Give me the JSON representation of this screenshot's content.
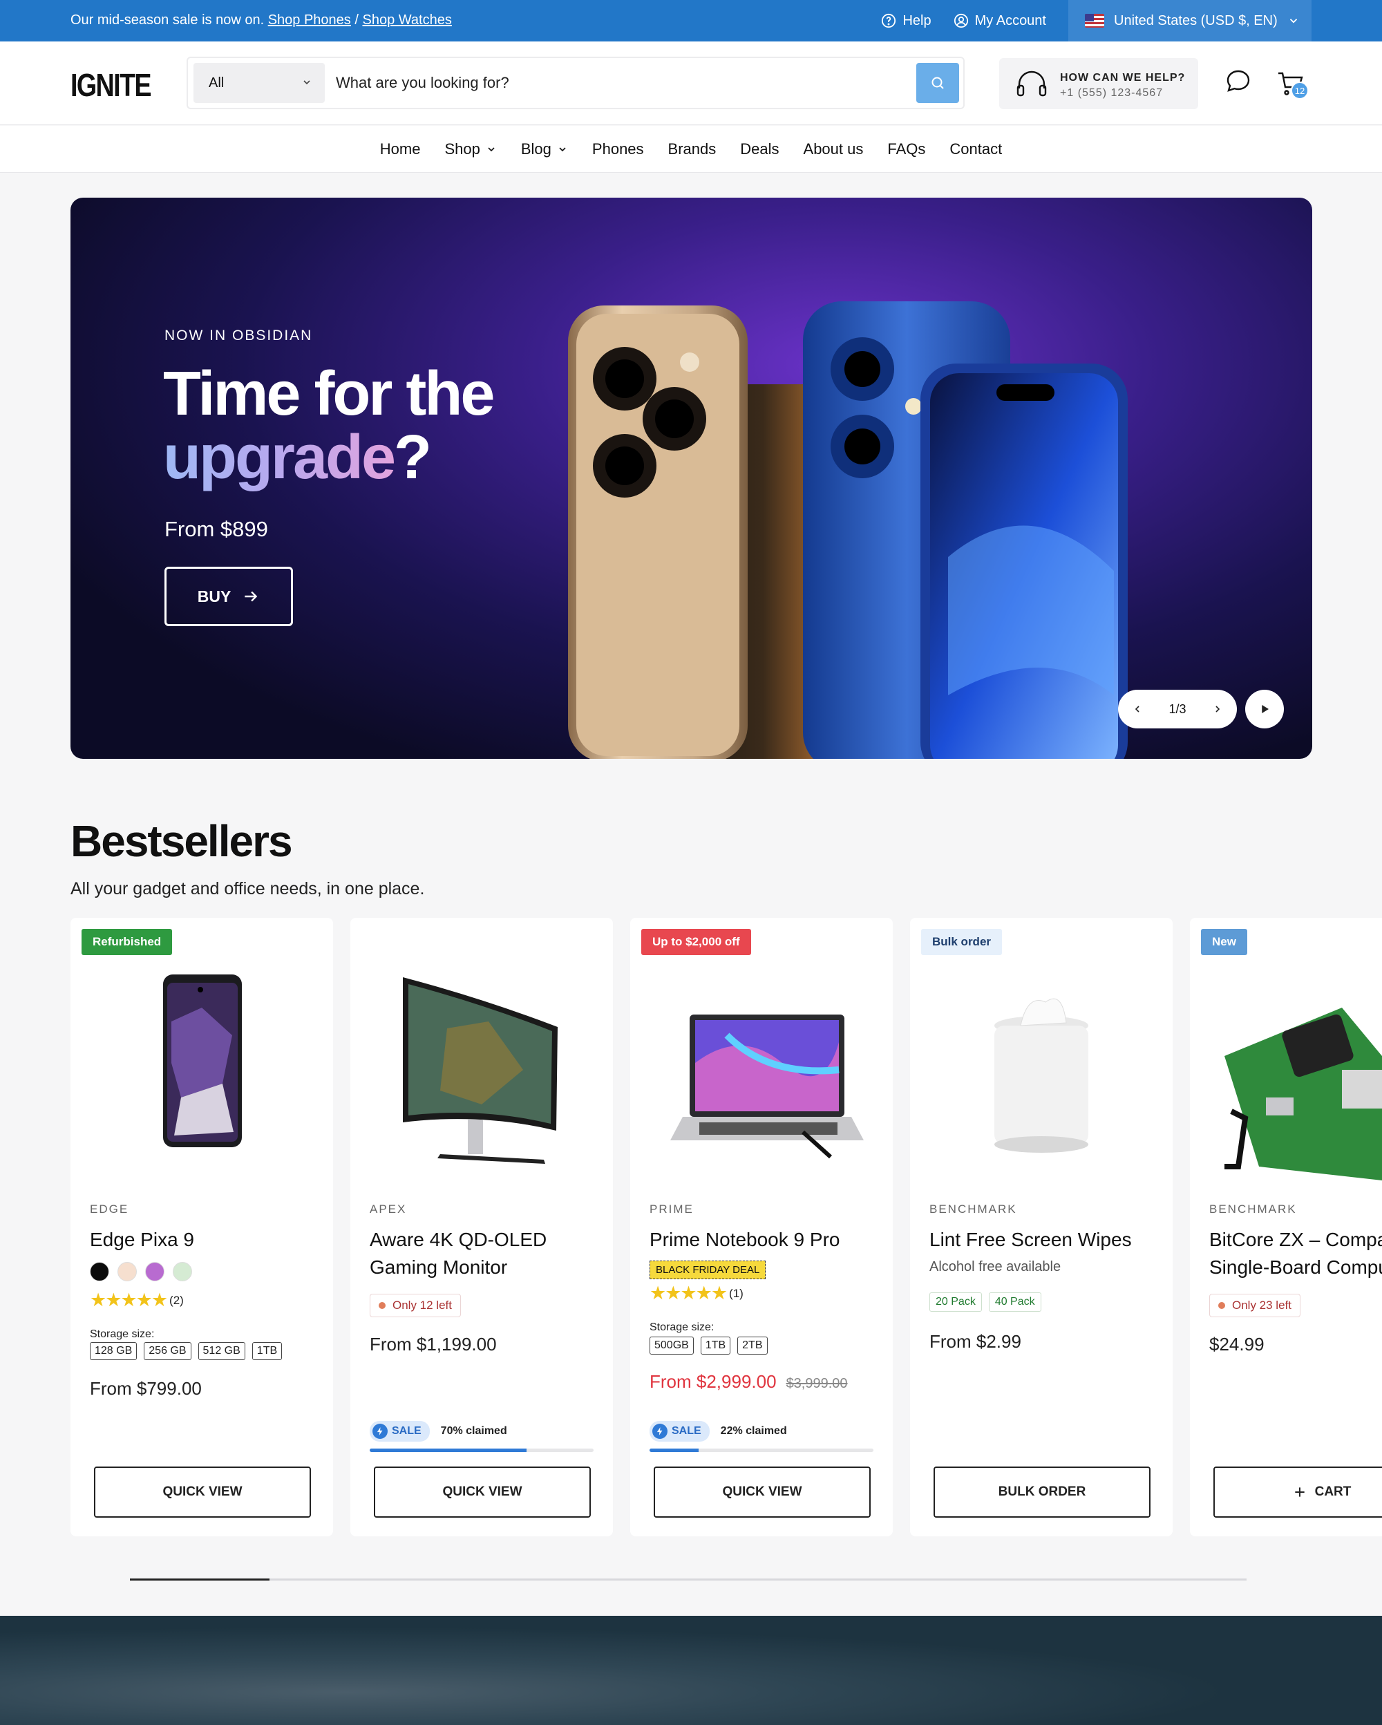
{
  "announcement": {
    "text": "Our mid-season sale is now on.",
    "link1": "Shop Phones",
    "separator": "/",
    "link2": "Shop Watches",
    "help": "Help",
    "account": "My Account",
    "locale": "United States (USD $, EN)"
  },
  "header": {
    "logo": "IGNITE",
    "search_category": "All",
    "search_placeholder": "What are you looking for?",
    "help_title": "HOW CAN WE HELP?",
    "help_phone": "+1 (555) 123-4567",
    "cart_count": "12"
  },
  "nav": {
    "items": [
      {
        "label": "Home"
      },
      {
        "label": "Shop"
      },
      {
        "label": "Blog"
      },
      {
        "label": "Phones"
      },
      {
        "label": "Brands"
      },
      {
        "label": "Deals"
      },
      {
        "label": "About us"
      },
      {
        "label": "FAQs"
      },
      {
        "label": "Contact"
      }
    ]
  },
  "hero": {
    "eyebrow": "NOW IN OBSIDIAN",
    "title_line1": "Time for the",
    "title_line2": "upgrade",
    "title_q": "?",
    "price": "From $899",
    "cta": "BUY",
    "pager": "1/3"
  },
  "bestsellers": {
    "title": "Bestsellers",
    "subtitle": "All your gadget and office needs, in one place.",
    "products": [
      {
        "badge": "Refurbished",
        "vendor": "EDGE",
        "title": "Edge Pixa 9",
        "swatches": [
          "#0b0b0b",
          "#f6dfcf",
          "#b86bd0",
          "#d5ebd3"
        ],
        "rating": "★★★★★",
        "reviews": "(2)",
        "option_label": "Storage size:",
        "options": [
          "128 GB",
          "256 GB",
          "512 GB",
          "1TB"
        ],
        "price": "From $799.00",
        "button": "QUICK VIEW"
      },
      {
        "vendor": "APEX",
        "title": "Aware 4K QD-OLED Gaming Monitor",
        "stock": "Only 12 left",
        "price": "From $1,199.00",
        "sale_label": "SALE",
        "claimed": "70% claimed",
        "claimed_pct": 70,
        "button": "QUICK VIEW"
      },
      {
        "badge": "Up to $2,000 off",
        "vendor": "PRIME",
        "title": "Prime Notebook 9 Pro",
        "tag": "BLACK FRIDAY DEAL",
        "rating": "★★★★★",
        "reviews": "(1)",
        "option_label": "Storage size:",
        "options": [
          "500GB",
          "1TB",
          "2TB"
        ],
        "price": "From $2,999.00",
        "compare_price": "$3,999.00",
        "sale_label": "SALE",
        "claimed": "22% claimed",
        "claimed_pct": 22,
        "button": "QUICK VIEW"
      },
      {
        "badge": "Bulk order",
        "vendor": "BENCHMARK",
        "title": "Lint Free Screen Wipes",
        "subtitle": "Alcohol free available",
        "packs": [
          "20 Pack",
          "40 Pack"
        ],
        "price": "From $2.99",
        "button": "BULK ORDER"
      },
      {
        "badge": "New",
        "vendor": "BENCHMARK",
        "title": "BitCore ZX – Compact Single-Board Computer",
        "stock": "Only 23 left",
        "price": "$24.99",
        "button": "CART"
      }
    ]
  },
  "colors": {
    "topbar": "#2277c8",
    "accent": "#4f9fe6",
    "sale_red": "#e0353f",
    "refurbished_badge": "#2e9a40",
    "discount_badge": "#e8474f",
    "bulk_badge": "#e6f0fb",
    "new_badge": "#5d9bd6"
  },
  "icons": [
    "help-circle-icon",
    "user-icon",
    "flag-us-icon",
    "chevron-down-icon",
    "search-icon",
    "headset-icon",
    "chat-icon",
    "cart-icon",
    "arrow-right-icon",
    "chevron-left-icon",
    "chevron-right-icon",
    "play-icon",
    "bolt-icon",
    "plus-icon"
  ]
}
